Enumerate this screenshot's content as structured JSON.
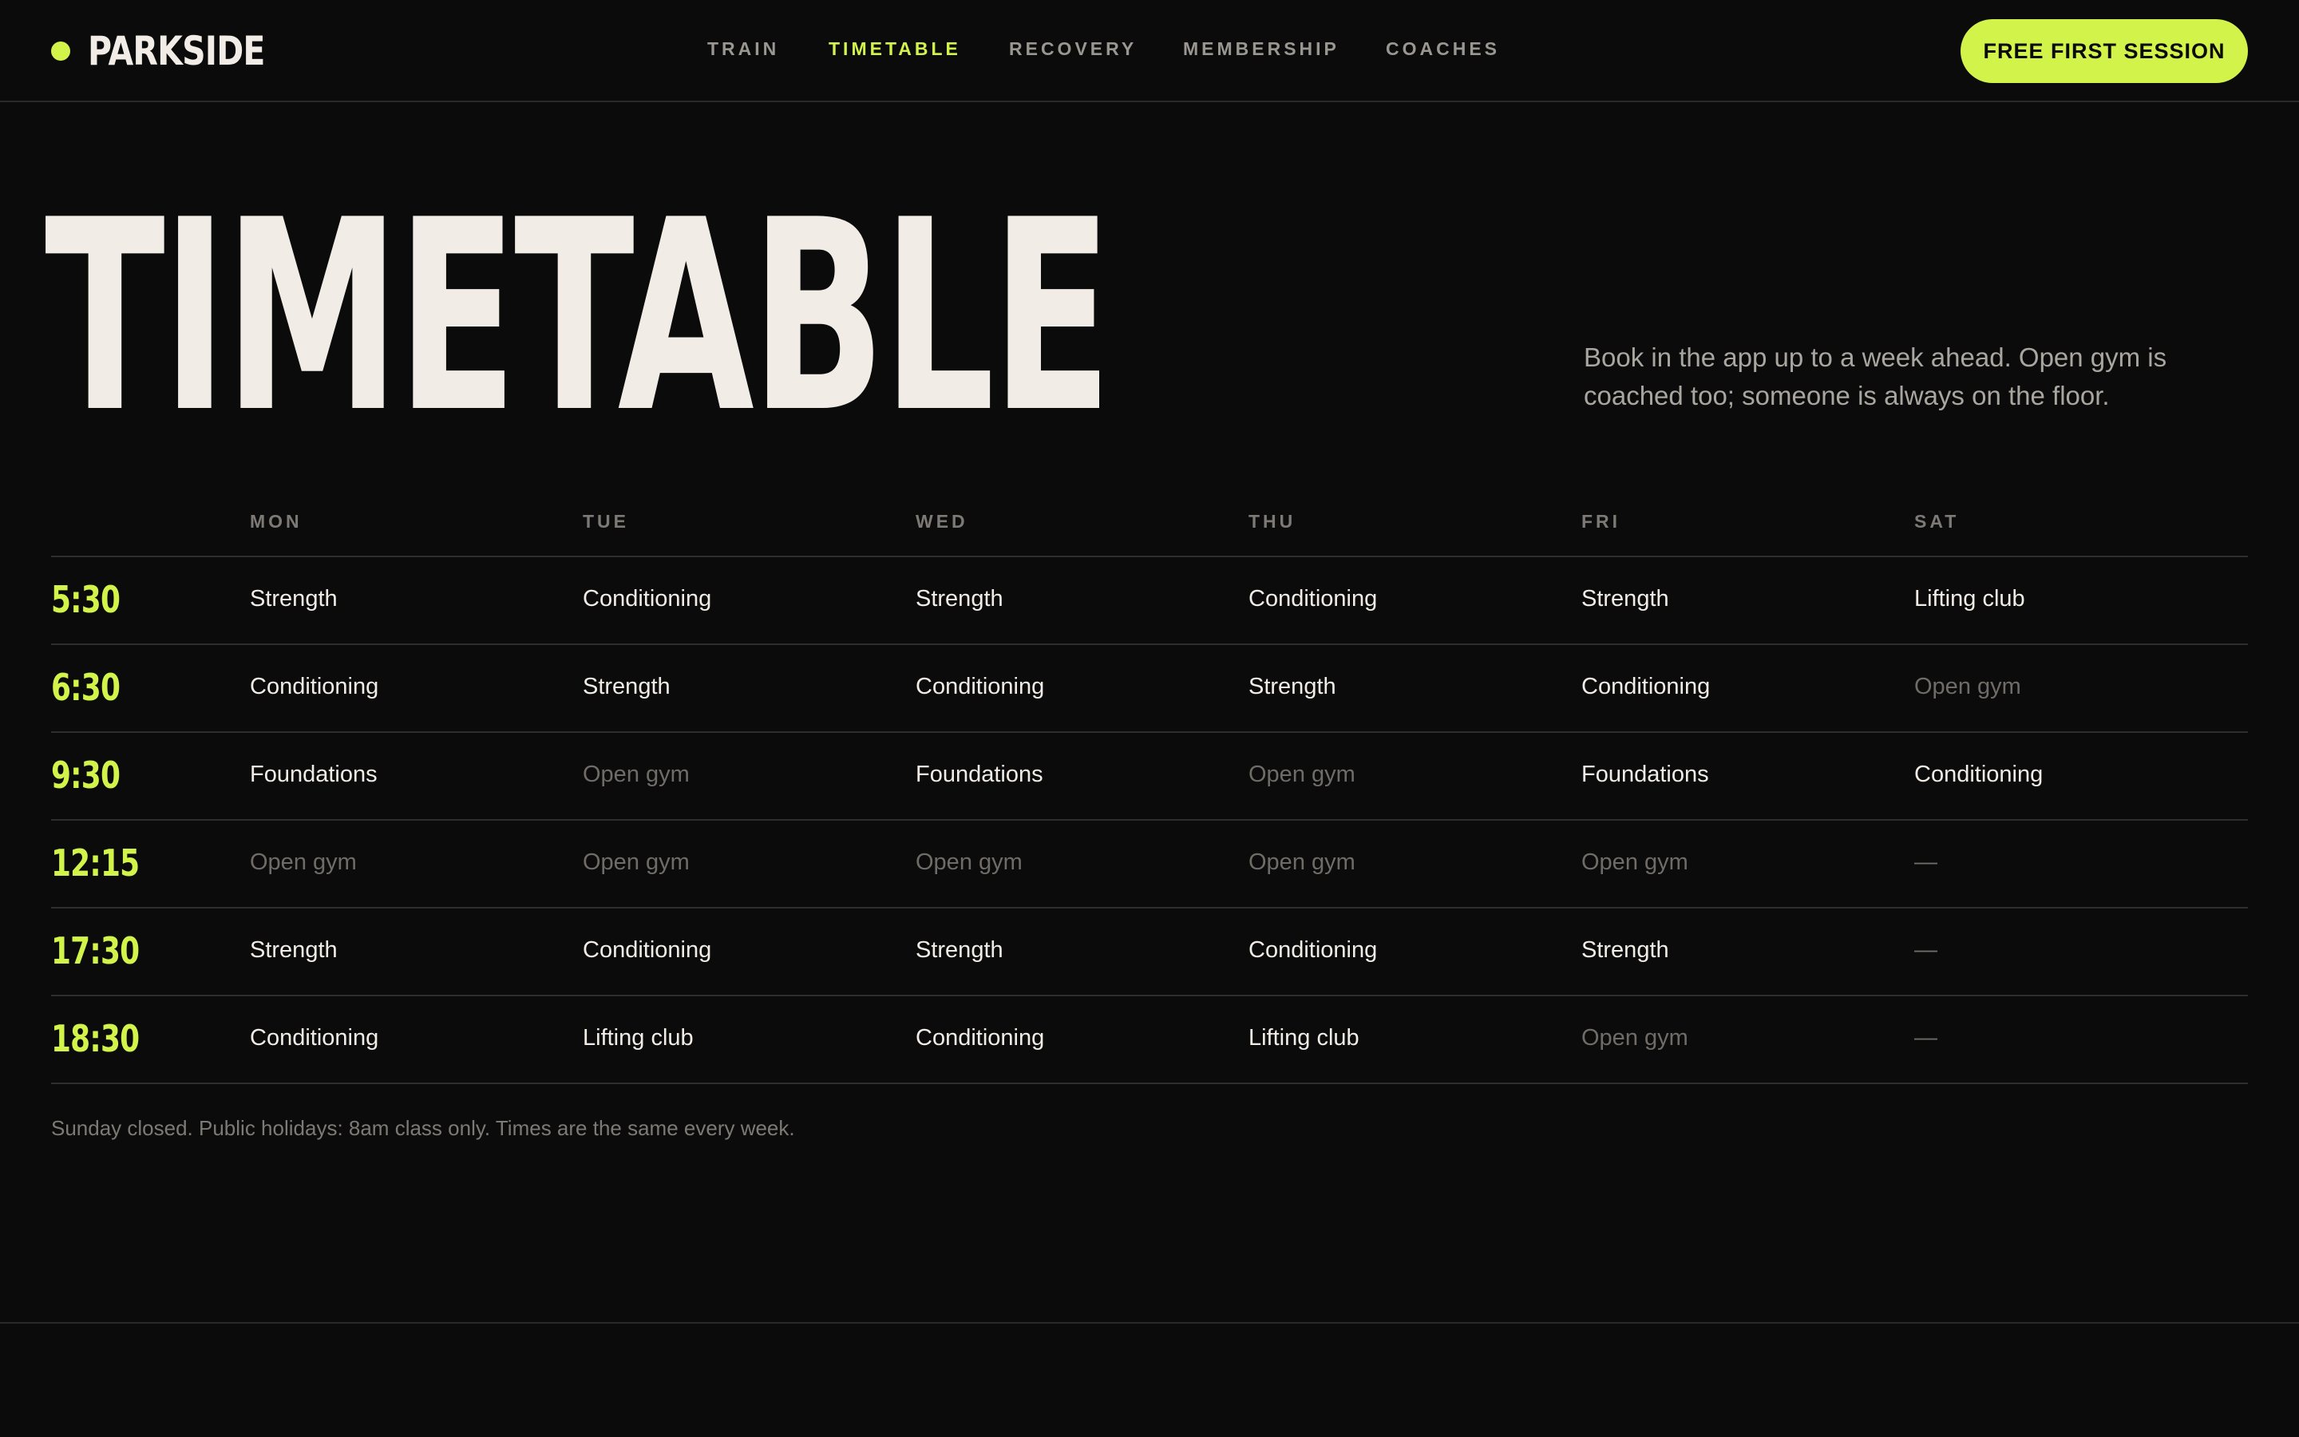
{
  "colors": {
    "background": "#0b0b0b",
    "accent": "#d2f34a",
    "text": "#f1ede6",
    "muted": "#6f6c68"
  },
  "header": {
    "brand": "PARKSIDE",
    "brand_icon": "dot-icon",
    "nav": [
      {
        "label": "TRAIN",
        "active": false
      },
      {
        "label": "TIMETABLE",
        "active": true
      },
      {
        "label": "RECOVERY",
        "active": false
      },
      {
        "label": "MEMBERSHIP",
        "active": false
      },
      {
        "label": "COACHES",
        "active": false
      }
    ],
    "cta_label": "FREE FIRST SESSION"
  },
  "hero": {
    "title": "TIMETABLE",
    "description": "Book in the app up to a week ahead. Open gym is coached too; someone is always on the floor."
  },
  "timetable": {
    "days": [
      "MON",
      "TUE",
      "WED",
      "THU",
      "FRI",
      "SAT"
    ],
    "rows": [
      {
        "time": "5:30",
        "cells": [
          {
            "text": "Strength",
            "style": "normal"
          },
          {
            "text": "Conditioning",
            "style": "normal"
          },
          {
            "text": "Strength",
            "style": "normal"
          },
          {
            "text": "Conditioning",
            "style": "normal"
          },
          {
            "text": "Strength",
            "style": "normal"
          },
          {
            "text": "Lifting club",
            "style": "normal"
          }
        ]
      },
      {
        "time": "6:30",
        "cells": [
          {
            "text": "Conditioning",
            "style": "normal"
          },
          {
            "text": "Strength",
            "style": "normal"
          },
          {
            "text": "Conditioning",
            "style": "normal"
          },
          {
            "text": "Strength",
            "style": "normal"
          },
          {
            "text": "Conditioning",
            "style": "normal"
          },
          {
            "text": "Open gym",
            "style": "muted"
          }
        ]
      },
      {
        "time": "9:30",
        "cells": [
          {
            "text": "Foundations",
            "style": "normal"
          },
          {
            "text": "Open gym",
            "style": "muted"
          },
          {
            "text": "Foundations",
            "style": "normal"
          },
          {
            "text": "Open gym",
            "style": "muted"
          },
          {
            "text": "Foundations",
            "style": "normal"
          },
          {
            "text": "Conditioning",
            "style": "normal"
          }
        ]
      },
      {
        "time": "12:15",
        "cells": [
          {
            "text": "Open gym",
            "style": "muted"
          },
          {
            "text": "Open gym",
            "style": "muted"
          },
          {
            "text": "Open gym",
            "style": "muted"
          },
          {
            "text": "Open gym",
            "style": "muted"
          },
          {
            "text": "Open gym",
            "style": "muted"
          },
          {
            "text": "—",
            "style": "dash"
          }
        ]
      },
      {
        "time": "17:30",
        "cells": [
          {
            "text": "Strength",
            "style": "normal"
          },
          {
            "text": "Conditioning",
            "style": "normal"
          },
          {
            "text": "Strength",
            "style": "normal"
          },
          {
            "text": "Conditioning",
            "style": "normal"
          },
          {
            "text": "Strength",
            "style": "normal"
          },
          {
            "text": "—",
            "style": "dash"
          }
        ]
      },
      {
        "time": "18:30",
        "cells": [
          {
            "text": "Conditioning",
            "style": "normal"
          },
          {
            "text": "Lifting club",
            "style": "normal"
          },
          {
            "text": "Conditioning",
            "style": "normal"
          },
          {
            "text": "Lifting club",
            "style": "normal"
          },
          {
            "text": "Open gym",
            "style": "muted"
          },
          {
            "text": "—",
            "style": "dash"
          }
        ]
      }
    ],
    "footnote": "Sunday closed. Public holidays: 8am class only. Times are the same every week."
  }
}
